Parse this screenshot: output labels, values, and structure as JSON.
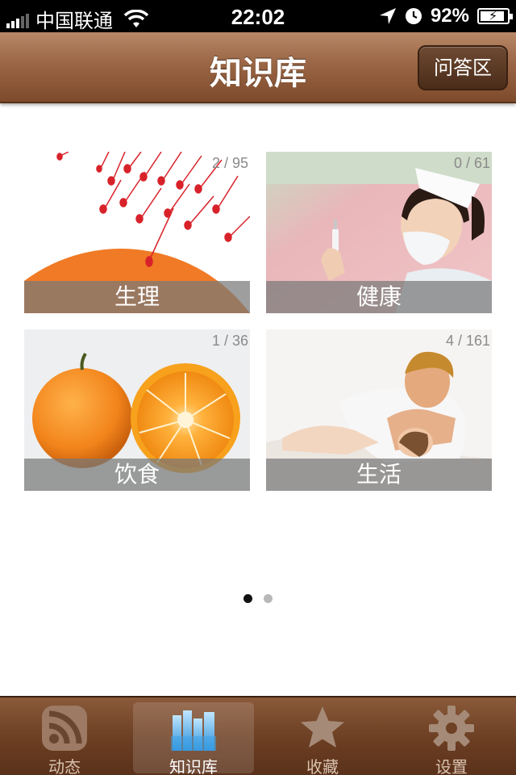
{
  "status_bar": {
    "carrier": "中国联通",
    "time": "22:02",
    "battery_percent": "92%",
    "battery_level": 0.92,
    "icons": [
      "signal-icon",
      "wifi-icon",
      "location-arrow-icon",
      "alarm-clock-icon",
      "battery-charging-icon"
    ]
  },
  "nav": {
    "title": "知识库",
    "right_button": "问答区"
  },
  "tiles": [
    {
      "label": "生理",
      "count": "2 / 95",
      "image": "sperm-and-egg-illustration"
    },
    {
      "label": "健康",
      "count": "0 / 61",
      "image": "nurse-with-syringe-photo"
    },
    {
      "label": "饮食",
      "count": "1 / 36",
      "image": "oranges-photo"
    },
    {
      "label": "生活",
      "count": "4 / 161",
      "image": "couple-on-bed-photo"
    }
  ],
  "pager": {
    "pages": 2,
    "current": 1
  },
  "tab_bar": {
    "tabs": [
      {
        "label": "动态",
        "icon": "rss-feed-icon",
        "selected": false
      },
      {
        "label": "知识库",
        "icon": "books-icon",
        "selected": true
      },
      {
        "label": "收藏",
        "icon": "star-icon",
        "selected": false
      },
      {
        "label": "设置",
        "icon": "gear-icon",
        "selected": false
      }
    ]
  },
  "colors": {
    "nav_brown": "#9a6645",
    "tab_brown": "#6e4024",
    "tile_label_overlay": "#787878",
    "orange": "#f07a25"
  }
}
